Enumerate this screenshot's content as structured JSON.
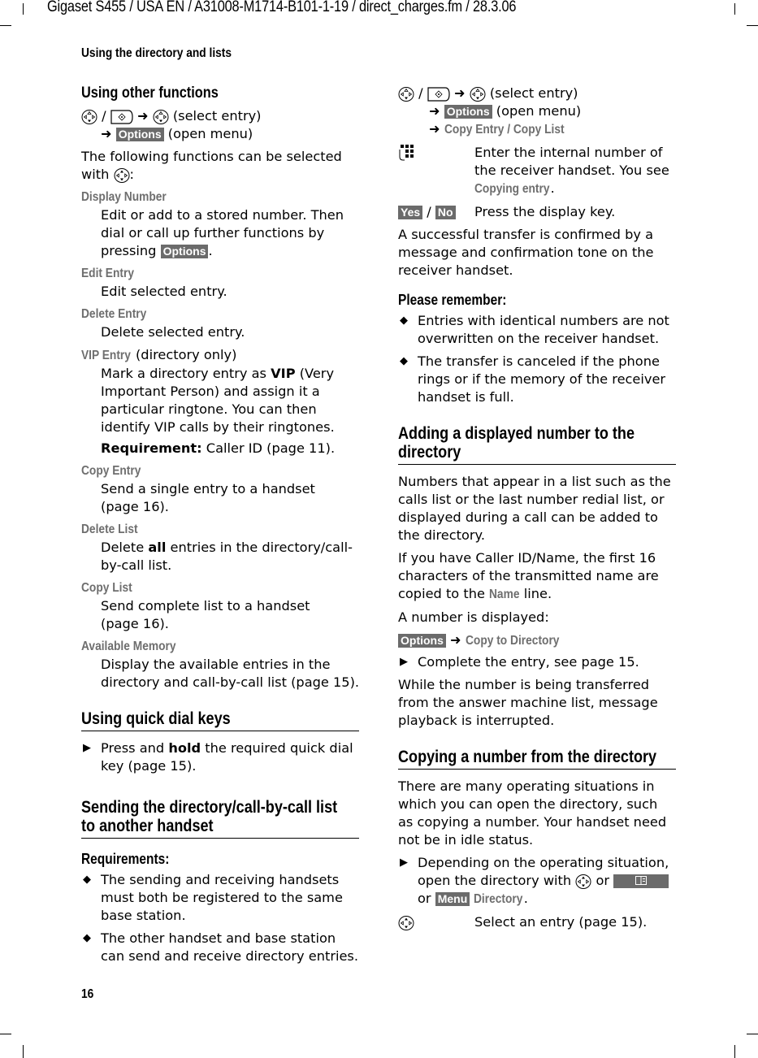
{
  "header": {
    "meta": "Gigaset S455 / USA EN / A31008-M1714-B101-1-19  / direct_charges.fm / 28.3.06",
    "running_head": "Using the directory and lists",
    "page_number": "16"
  },
  "left": {
    "other_functions": {
      "title": "Using other functions",
      "nav_select": "(select entry)",
      "options_key": "Options",
      "open_menu": "(open menu)",
      "intro_a": "The following functions can be selected with",
      "intro_b": ":",
      "items": [
        {
          "term": "Display Number",
          "desc_a": "Edit or add to a stored number. Then dial or call up further functions by pressing",
          "desc_key": "Options",
          "desc_b": "."
        },
        {
          "term": "Edit Entry",
          "desc": "Edit selected entry."
        },
        {
          "term": "Delete Entry",
          "desc": "Delete selected entry."
        },
        {
          "term": "VIP Entry",
          "term_suffix": " (directory only)",
          "desc_a": "Mark a directory entry as ",
          "desc_bold": "VIP",
          "desc_b": " (Very Important Person) and assign it a particular ringtone. You can then identify VIP calls by their ringtones.",
          "req_label": "Requirement:",
          "req_text": " Caller ID (page 11)."
        },
        {
          "term": "Copy Entry",
          "desc": "Send a single entry to a handset (page 16)."
        },
        {
          "term": "Delete List",
          "desc_a": "Delete ",
          "desc_bold": "all",
          "desc_b": " entries in the directory/call-by-call list."
        },
        {
          "term": "Copy List",
          "desc": "Send complete list to a handset (page 16)."
        },
        {
          "term": "Available Memory",
          "desc": "Display the available entries in the directory and call-by-call list (page 15)."
        }
      ]
    },
    "quick_dial": {
      "title": "Using quick dial keys",
      "bullet_a": "Press and ",
      "bullet_bold": "hold",
      "bullet_b": " the required quick dial key (page 15)."
    },
    "sending": {
      "title_1": "Sending the directory/call-by-call list",
      "title_2": "to another handset",
      "req_title": "Requirements:",
      "bullets": [
        "The sending and receiving handsets must both be registered to the same base station.",
        "The other handset and base station can send and receive directory entries."
      ]
    }
  },
  "right": {
    "copy_steps": {
      "nav_select": "(select entry)",
      "options_key": "Options",
      "open_menu": "(open menu)",
      "copy_entry": "Copy Entry",
      "sep": " / ",
      "copy_list": "Copy List",
      "keypad_text_a": "Enter the internal number of the receiver handset. You see ",
      "keypad_menu": "Copying entry",
      "keypad_text_b": ".",
      "yes_key": "Yes",
      "no_key": "No",
      "yesno_text": "Press the display key.",
      "success": "A successful transfer is confirmed by a message and confirmation tone on the receiver handset."
    },
    "remember": {
      "title": "Please remember:",
      "bullets": [
        "Entries with identical numbers are not overwritten on the receiver handset.",
        "The transfer is canceled if the phone rings or if the memory of the receiver handset is full."
      ]
    },
    "adding": {
      "title_1": "Adding a displayed number to the",
      "title_2": "directory",
      "p1": "Numbers that appear in a list such as the calls list or the last number redial list,  or displayed during a call can be added to the directory.",
      "p2_a": "If you have Caller ID/Name, the first 16 characters of the transmitted name are copied to the ",
      "p2_menu": "Name",
      "p2_b": " line.",
      "p3": "A number is displayed:",
      "options_key": "Options",
      "copy_to_dir": "Copy to Directory",
      "bullet": "Complete the entry, see page 15.",
      "p4": "While the number is being transferred from the answer machine list, message playback is interrupted."
    },
    "copying": {
      "title": "Copying a number from the directory",
      "p1": "There are many operating situations in which you can open the directory, such as copying a number. Your handset need not be in idle status.",
      "bullet_a": "Depending on the operating situation, open the directory with",
      "bullet_or1": " or ",
      "bullet_or2": "or ",
      "menu_key": "Menu",
      "directory": "Directory",
      "bullet_end": ".",
      "select_text": "Select an entry (page 15)."
    }
  },
  "symbols": {
    "arrow": "➜",
    "triangle_bullet": "▶",
    "diamond_bullet": "◆"
  }
}
